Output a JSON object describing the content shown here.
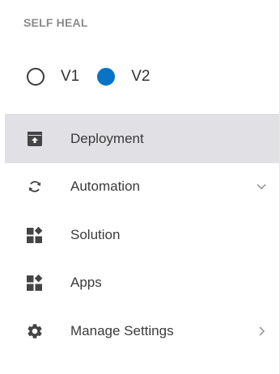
{
  "section_title": "SELF HEAL",
  "versions": [
    {
      "label": "V1",
      "selected": false
    },
    {
      "label": "V2",
      "selected": true
    }
  ],
  "colors": {
    "accent": "#0a74c4",
    "active_bg": "#e1e1e5",
    "icon": "#444444"
  },
  "menu": [
    {
      "label": "Deployment",
      "icon": "deploy-box-icon",
      "active": true,
      "chevron": ""
    },
    {
      "label": "Automation",
      "icon": "sync-icon",
      "active": false,
      "chevron": "chevron-down-icon"
    },
    {
      "label": "Solution",
      "icon": "widgets-icon",
      "active": false,
      "chevron": ""
    },
    {
      "label": "Apps",
      "icon": "widgets-icon",
      "active": false,
      "chevron": ""
    },
    {
      "label": "Manage Settings",
      "icon": "gear-icon",
      "active": false,
      "chevron": "chevron-right-icon"
    }
  ]
}
